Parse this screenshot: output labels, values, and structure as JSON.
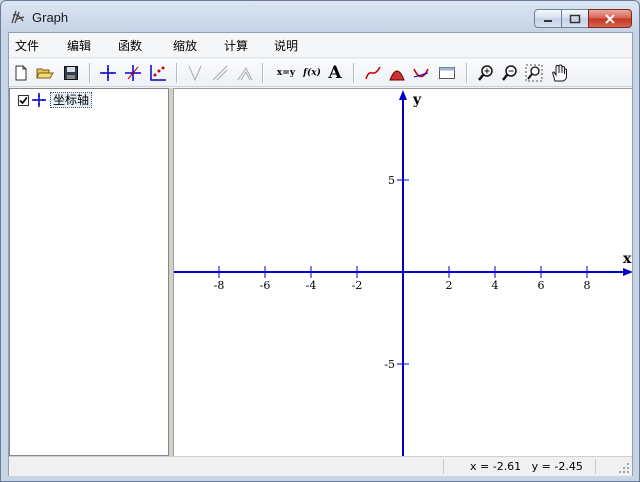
{
  "window": {
    "title": "Graph"
  },
  "menu": [
    "文件",
    "编辑",
    "函数",
    "缩放",
    "计算",
    "说明"
  ],
  "toolbar": {
    "new_icon": "new-file-icon",
    "open_icon": "open-folder-icon",
    "save_icon": "save-disk-icon",
    "text_xy": "x=y",
    "text_fx": "f(x)",
    "text_A": "A"
  },
  "tree": {
    "checked": true,
    "item_label": "坐标轴"
  },
  "graph": {
    "x_label": "x",
    "y_label": "y",
    "x_ticks": [
      "-8",
      "-6",
      "-4",
      "-2",
      "2",
      "4",
      "6",
      "8"
    ],
    "y_ticks": [
      "5",
      "-5"
    ],
    "axis_color": "#0000cc"
  },
  "status": {
    "coords": "x = -2.61   y = -2.45"
  }
}
